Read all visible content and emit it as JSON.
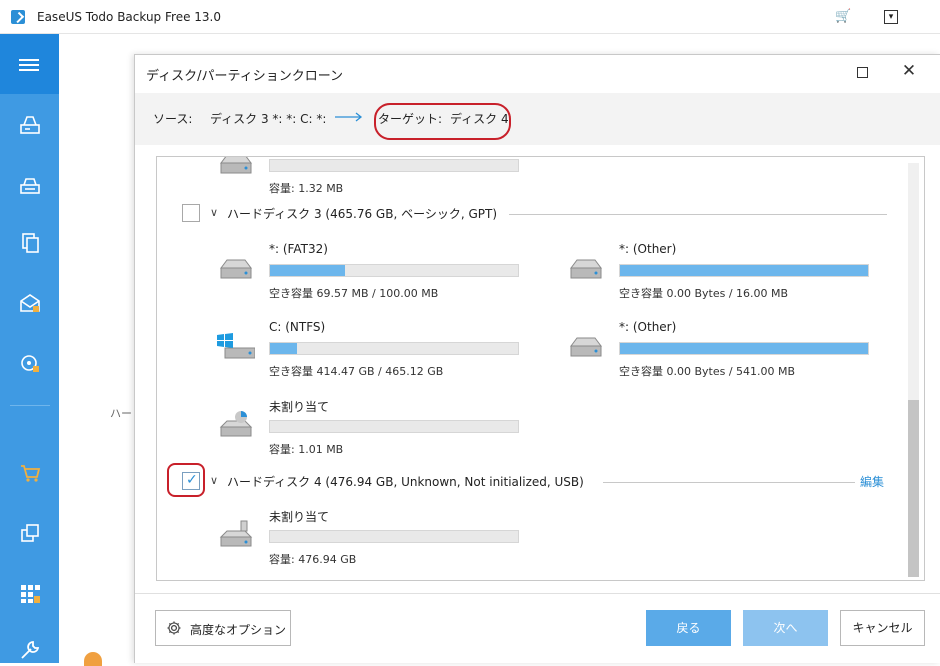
{
  "app": {
    "title": "EaseUS Todo Backup Free 13.0",
    "cart_icon": "cart-icon",
    "menu_icon": "dropdown-icon"
  },
  "sidebar": {
    "items": [
      {
        "name": "disk-backup",
        "icon": "disk-backup-icon"
      },
      {
        "name": "system-backup",
        "icon": "system-backup-icon"
      },
      {
        "name": "file-backup",
        "icon": "file-backup-icon"
      },
      {
        "name": "mail-backup",
        "icon": "mail-icon"
      },
      {
        "name": "smart-backup",
        "icon": "smart-icon"
      },
      {
        "name": "store",
        "icon": "cart-icon"
      },
      {
        "name": "clone",
        "icon": "clone-icon"
      },
      {
        "name": "tools",
        "icon": "apps-icon"
      },
      {
        "name": "settings",
        "icon": "wrench-icon"
      }
    ]
  },
  "background": {
    "stub_text": "ハー"
  },
  "dialog": {
    "title": "ディスク/パーティションクローン",
    "source_label": "ソース:",
    "source_value": "ディスク 3 *: *: C: *:",
    "target_label": "ターゲット:",
    "target_value": "ディスク 4",
    "disks": [
      {
        "label": "ハードディスク 3 (465.76 GB, ベーシック, GPT)",
        "checked": false,
        "partitions": [
          {
            "name": "*: (FAT32)",
            "info": "空き容量 69.57 MB / 100.00 MB",
            "used_fraction": 0.304
          },
          {
            "name": "*: (Other)",
            "info": "空き容量 0.00 Bytes / 16.00 MB",
            "used_fraction": 1.0
          },
          {
            "name": "C: (NTFS)",
            "info": "空き容量 414.47 GB / 465.12 GB",
            "used_fraction": 0.109
          },
          {
            "name": "*: (Other)",
            "info": "空き容量 0.00 Bytes / 541.00 MB",
            "used_fraction": 1.0
          },
          {
            "name": "未割り当て",
            "info": "容量: 1.01 MB",
            "used_fraction": 0.0
          }
        ]
      },
      {
        "label": "ハードディスク 4 (476.94 GB, Unknown, Not initialized, USB)",
        "checked": true,
        "edit_label": "編集",
        "partitions": [
          {
            "name": "未割り当て",
            "info": "容量: 476.94 GB",
            "used_fraction": 0.0
          }
        ]
      }
    ],
    "top_partial": {
      "info": "容量: 1.32 MB"
    },
    "advanced_label": "高度なオプション",
    "back_label": "戻る",
    "next_label": "次へ",
    "cancel_label": "キャンセル"
  }
}
